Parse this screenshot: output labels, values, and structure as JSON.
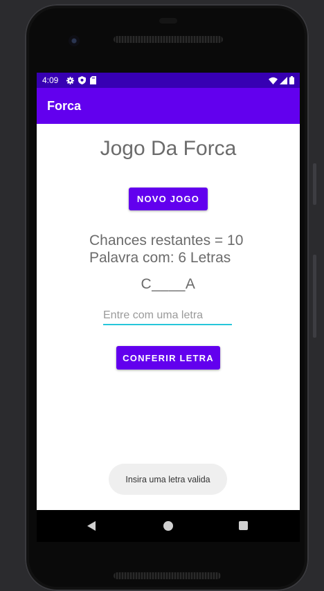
{
  "status_bar": {
    "time": "4:09",
    "left_icons": [
      "gear-icon",
      "shield-icon",
      "sd-card-icon"
    ],
    "right_icons": [
      "wifi-icon",
      "signal-icon",
      "battery-icon"
    ],
    "color": "#3700b3"
  },
  "app_bar": {
    "title": "Forca",
    "color": "#6200ee"
  },
  "game": {
    "title": "Jogo Da Forca",
    "new_game_button": "NOVO JOGO",
    "chances_text": "Chances restantes = 10",
    "word_length_text": "Palavra com: 6 Letras",
    "masked_word": "C____A",
    "letter_input": {
      "value": "",
      "placeholder": "Entre com uma letra"
    },
    "check_button": "CONFERIR LETRA"
  },
  "toast": {
    "message": "Insira uma letra valida"
  },
  "nav_bar": {
    "icons": [
      "back-icon",
      "home-icon",
      "recents-icon"
    ]
  },
  "colors": {
    "accent": "#6200ee",
    "input_underline": "#26c6da",
    "text_gray": "#6b6b6b"
  }
}
